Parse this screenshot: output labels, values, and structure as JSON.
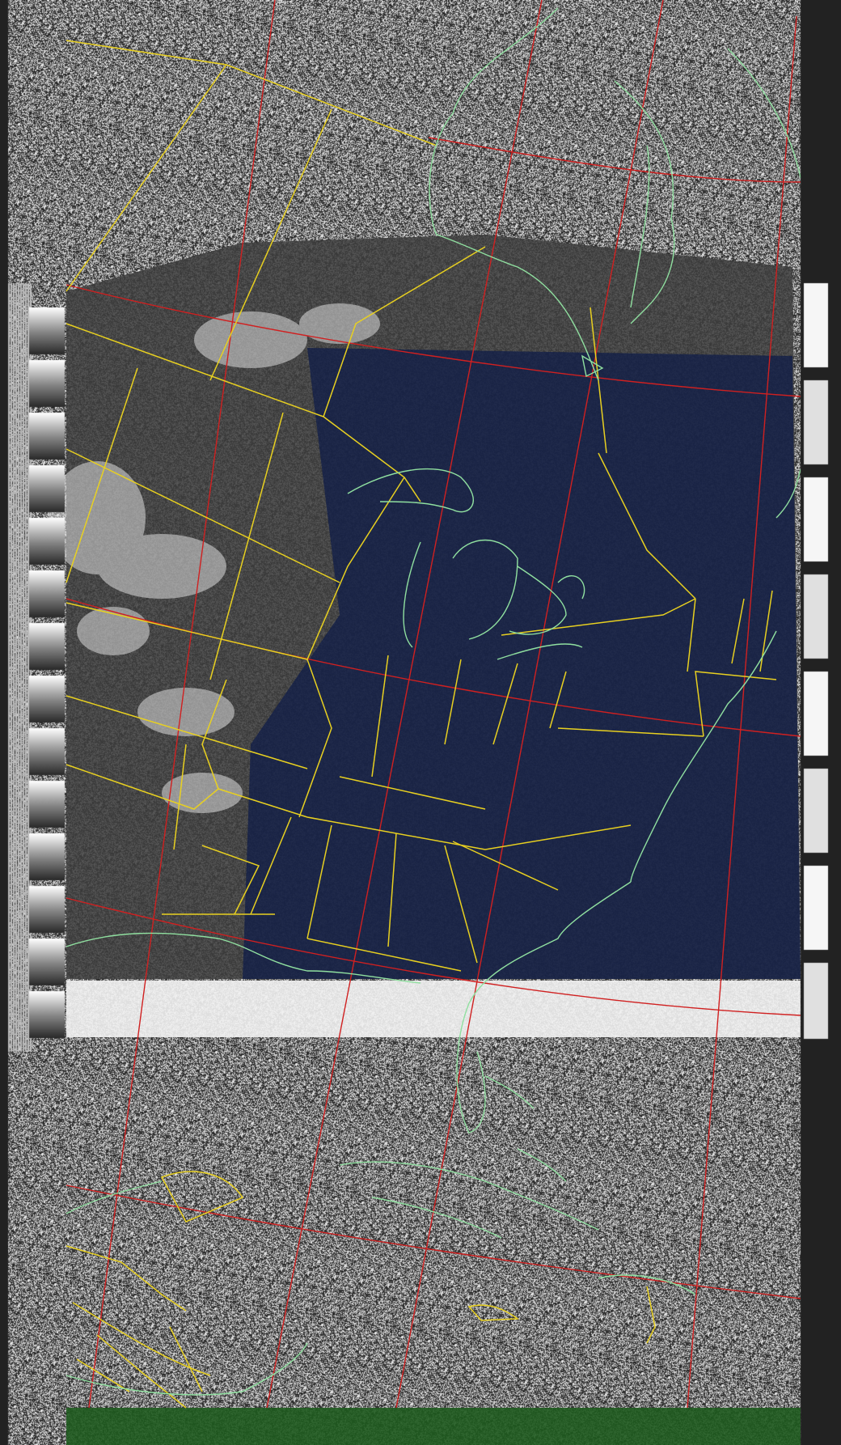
{
  "image": {
    "kind": "NOAA APT weather satellite image (false-color composite)",
    "colors": {
      "background_noise_dark": "#1a1a1a",
      "background_noise_light": "#cfcfcf",
      "cloud_white": "#e8e8e8",
      "land_gray": "#4a4a4a",
      "water_navy": "#0d1a44",
      "sensor_gap_white": "#f2f2f2",
      "bottom_noise_green": "#1e5a1e",
      "border_state_yellow": "#e8d020",
      "coastline_green": "#90e0a0",
      "graticule_red": "#d02020",
      "telemetry_dark": "#222222",
      "telemetry_light": "#d8d8d8"
    }
  },
  "layers": [
    {
      "name": "noise-background"
    },
    {
      "name": "cloud-cover"
    },
    {
      "name": "land-surface"
    },
    {
      "name": "great-lakes-water"
    },
    {
      "name": "sensor-gap-band"
    },
    {
      "name": "graticule-lines"
    },
    {
      "name": "state-borders"
    },
    {
      "name": "coastlines"
    },
    {
      "name": "telemetry-sync-strips"
    }
  ]
}
